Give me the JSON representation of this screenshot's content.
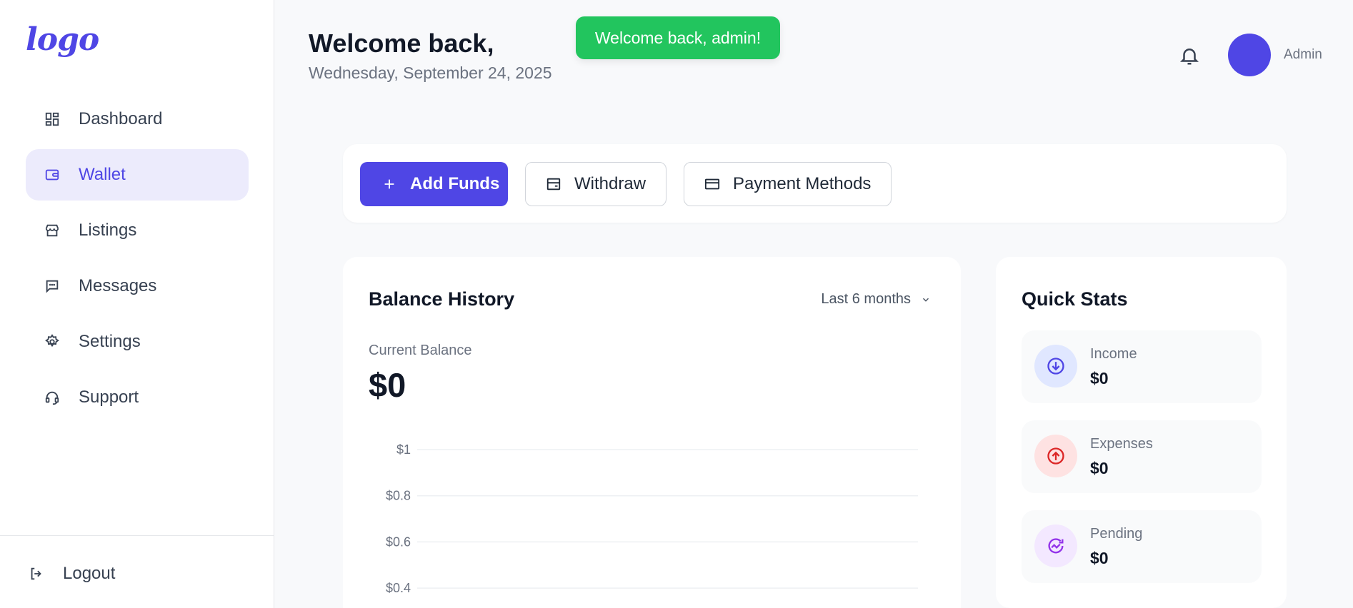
{
  "sidebar": {
    "logo_text": "logo",
    "items": [
      {
        "label": "Dashboard",
        "icon": "dashboard-icon",
        "active": false
      },
      {
        "label": "Wallet",
        "icon": "wallet-icon",
        "active": true
      },
      {
        "label": "Listings",
        "icon": "store-icon",
        "active": false
      },
      {
        "label": "Messages",
        "icon": "message-icon",
        "active": false
      },
      {
        "label": "Settings",
        "icon": "gear-icon",
        "active": false
      },
      {
        "label": "Support",
        "icon": "headset-icon",
        "active": false
      }
    ],
    "logout_label": "Logout"
  },
  "header": {
    "title": "Welcome back,",
    "date": "Wednesday, September 24, 2025",
    "toast": "Welcome back, admin!",
    "user_name": "Admin"
  },
  "actions": {
    "add_funds": "Add Funds",
    "withdraw": "Withdraw",
    "payment_methods": "Payment Methods"
  },
  "balance": {
    "title": "Balance History",
    "range": "Last 6 months",
    "current_label": "Current Balance",
    "current_value": "$0"
  },
  "quick_stats": {
    "title": "Quick Stats",
    "items": [
      {
        "label": "Income",
        "value": "$0",
        "icon": "arrow-down-circle-icon",
        "color": "#4f46e5",
        "bg": "#e0e7ff"
      },
      {
        "label": "Expenses",
        "value": "$0",
        "icon": "arrow-up-circle-icon",
        "color": "#dc2626",
        "bg": "#fee2e2"
      },
      {
        "label": "Pending",
        "value": "$0",
        "icon": "pending-icon",
        "color": "#9333ea",
        "bg": "#f3e8ff"
      }
    ]
  },
  "colors": {
    "accent": "#4f46e5",
    "toast": "#22c55e"
  },
  "chart_data": {
    "type": "line",
    "y_tick_labels": [
      "$1",
      "$0.8",
      "$0.6",
      "$0.4"
    ],
    "y_ticks": [
      1,
      0.8,
      0.6,
      0.4
    ],
    "grid": true
  }
}
